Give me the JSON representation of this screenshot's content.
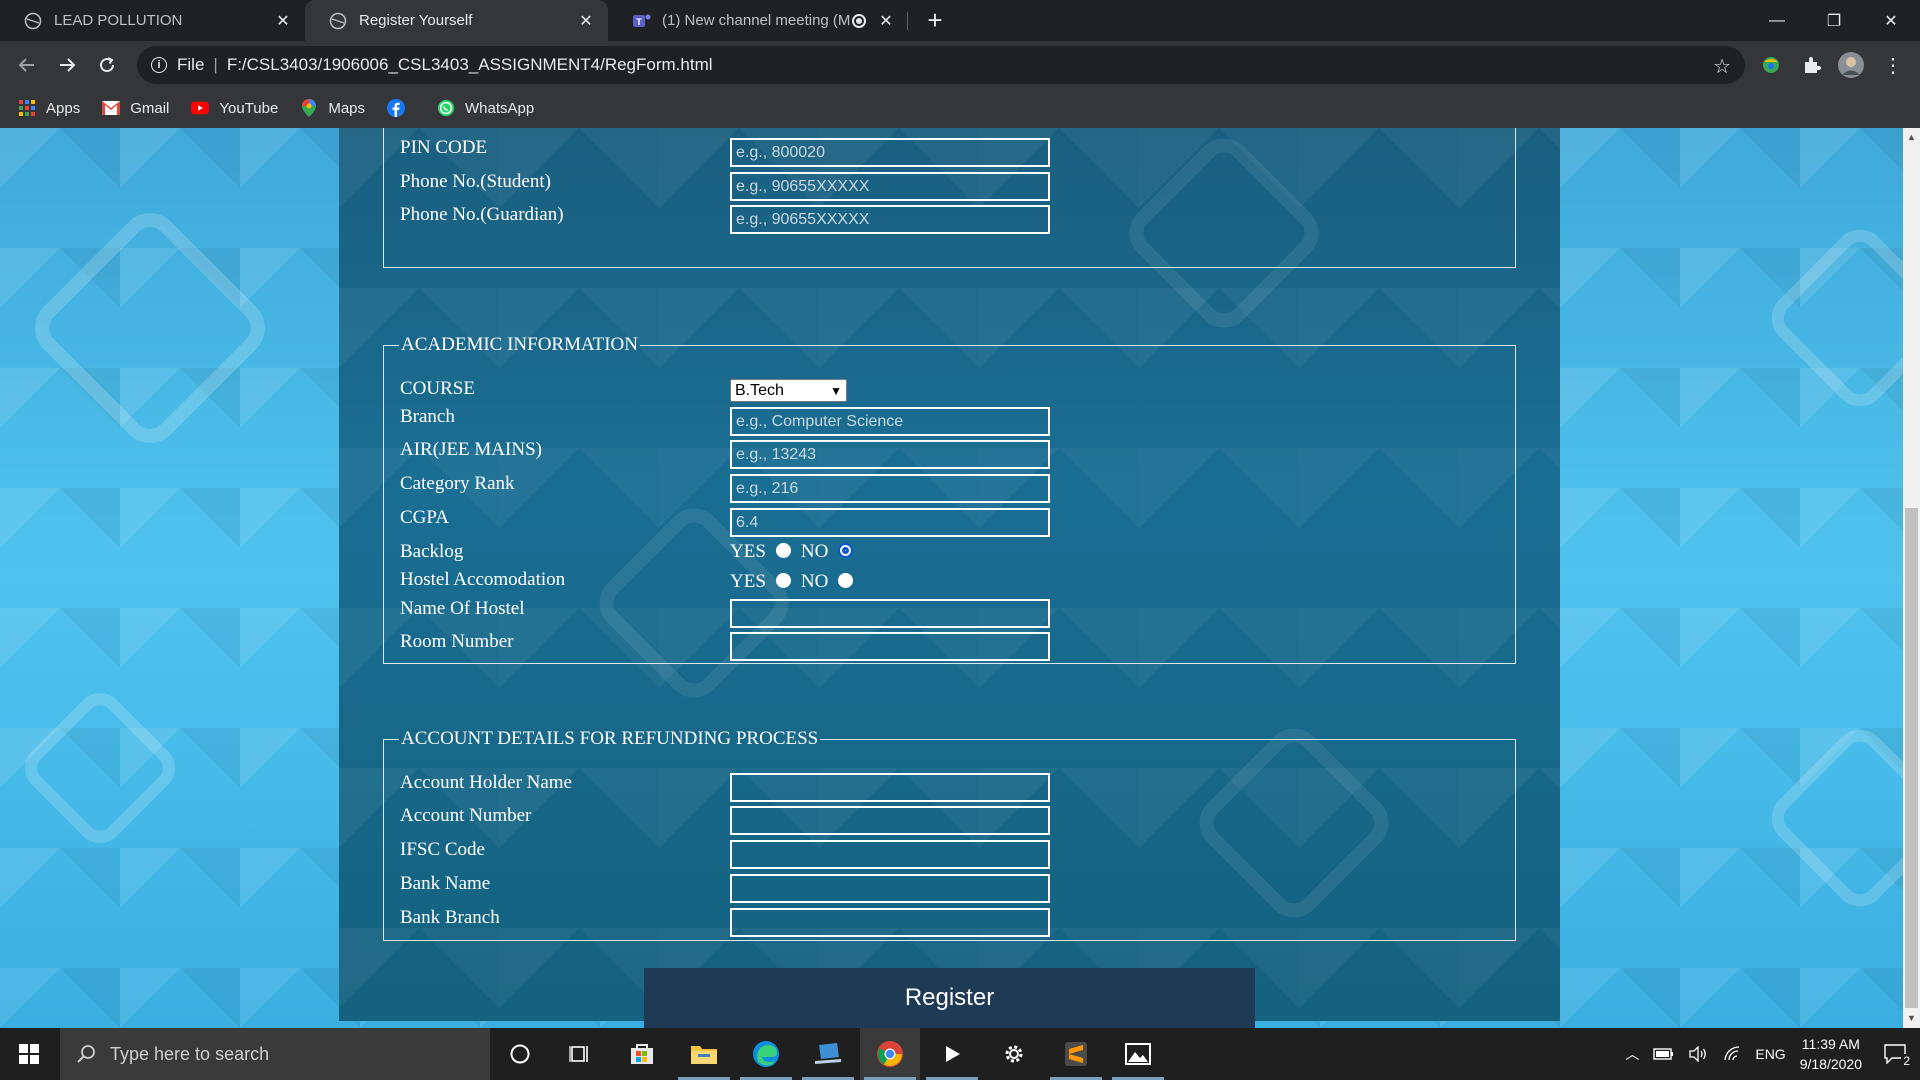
{
  "browser": {
    "tabs": [
      {
        "title": "LEAD POLLUTION",
        "active": false
      },
      {
        "title": "Register Yourself",
        "active": true
      },
      {
        "title": "(1) New channel meeting (M",
        "active": false
      }
    ],
    "new_tab": "+",
    "url_scheme": "File",
    "url": "F:/CSL3403/1906006_CSL3403_ASSIGNMENT4/RegForm.html",
    "bookmarks": [
      "Apps",
      "Gmail",
      "YouTube",
      "Maps",
      "",
      "WhatsApp"
    ]
  },
  "form": {
    "contact_section": {
      "rows": [
        {
          "label": "PIN CODE",
          "placeholder": "e.g., 800020"
        },
        {
          "label": "Phone No.(Student)",
          "placeholder": "e.g., 90655XXXXX"
        },
        {
          "label": "Phone No.(Guardian)",
          "placeholder": "e.g., 90655XXXXX"
        }
      ]
    },
    "academic": {
      "legend": "ACADEMIC INFORMATION",
      "course_label": "COURSE",
      "course_value": "B.Tech",
      "branch_label": "Branch",
      "branch_placeholder": "e.g., Computer Science",
      "air_label": "AIR(JEE MAINS)",
      "air_placeholder": "e.g., 13243",
      "rank_label": "Category Rank",
      "rank_placeholder": "e.g., 216",
      "cgpa_label": "CGPA",
      "cgpa_value": "6.4",
      "backlog_label": "Backlog",
      "hostel_label": "Hostel Accomodation",
      "yes": "YES",
      "no": "NO",
      "backlog_selected": "NO",
      "hostel_name_label": "Name Of Hostel",
      "room_label": "Room Number"
    },
    "account": {
      "legend": "ACCOUNT DETAILS FOR REFUNDING PROCESS",
      "holder_label": "Account Holder Name",
      "number_label": "Account Number",
      "ifsc_label": "IFSC Code",
      "bank_label": "Bank Name",
      "branch_label": "Bank Branch"
    },
    "register_label": "Register"
  },
  "taskbar": {
    "search_placeholder": "Type here to search",
    "lang": "ENG",
    "time": "11:39 AM",
    "date": "9/18/2020",
    "notifications": "2"
  }
}
